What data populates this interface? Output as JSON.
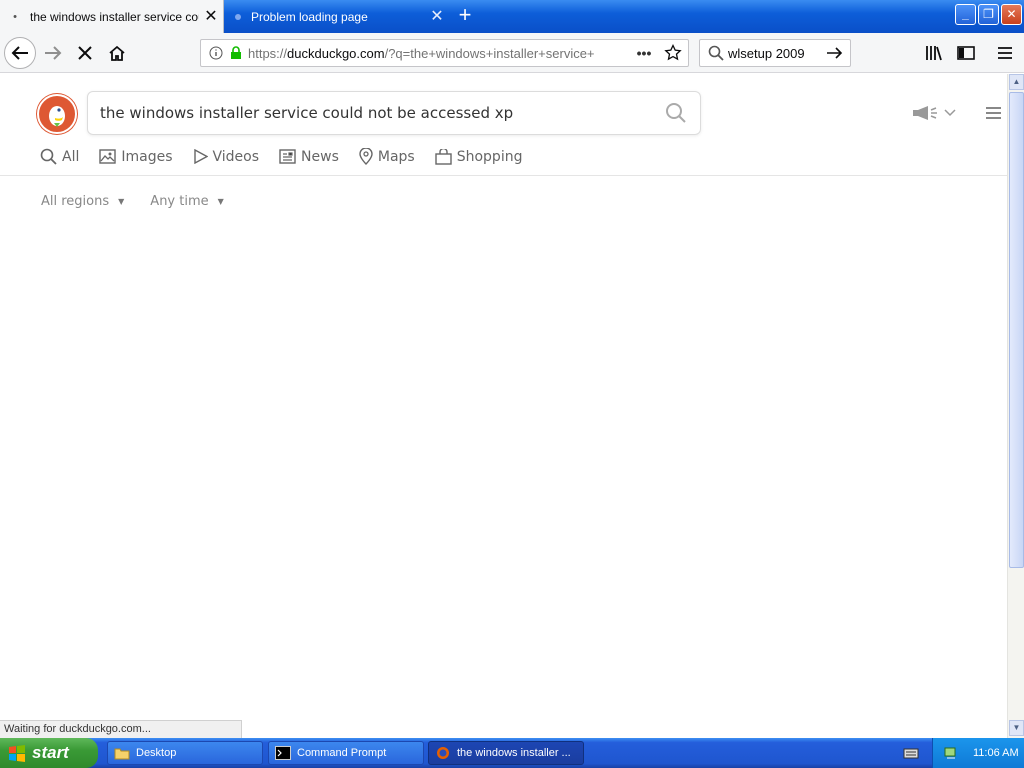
{
  "browser": {
    "tabs": [
      {
        "title": "the windows installer service could not be accessed xp",
        "active": true
      },
      {
        "title": "Problem loading page",
        "active": false
      }
    ],
    "url": {
      "scheme": "https://",
      "host": "duckduckgo.com",
      "path": "/?q=the+windows+installer+service+"
    },
    "search_value": "wlsetup 2009",
    "status_text": "Waiting for duckduckgo.com..."
  },
  "ddg": {
    "query": "the windows installer service could not be accessed xp",
    "tabs": [
      {
        "label": "All",
        "icon": "search-icon"
      },
      {
        "label": "Images",
        "icon": "image-icon"
      },
      {
        "label": "Videos",
        "icon": "play-icon"
      },
      {
        "label": "News",
        "icon": "newspaper-icon"
      },
      {
        "label": "Maps",
        "icon": "map-pin-icon"
      },
      {
        "label": "Shopping",
        "icon": "shopping-bag-icon"
      }
    ],
    "filters": {
      "region": "All regions",
      "time": "Any time"
    }
  },
  "taskbar": {
    "start_label": "start",
    "tasks": [
      {
        "label": "Desktop",
        "icon": "folder-icon"
      },
      {
        "label": "Command Prompt",
        "icon": "cmd-icon"
      },
      {
        "label": "the windows installer ...",
        "icon": "firefox-icon",
        "active": true
      }
    ],
    "clock": "11:06 AM"
  },
  "colors": {
    "ddg_brand": "#de5833",
    "xp_taskbar": "#245edb",
    "xp_start": "#3a9a36"
  }
}
